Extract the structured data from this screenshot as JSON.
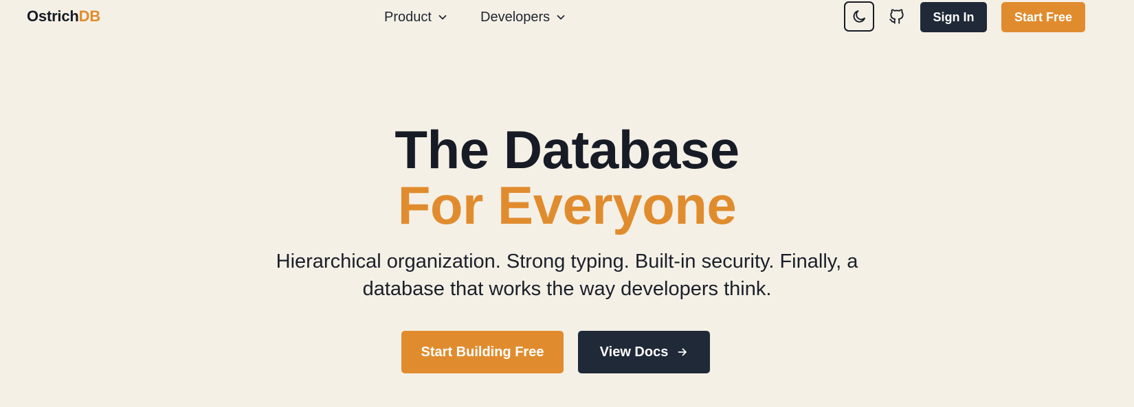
{
  "header": {
    "logo": {
      "main": "Ostrich",
      "accent": "DB"
    },
    "nav": [
      {
        "label": "Product",
        "icon": "chevron-down-icon"
      },
      {
        "label": "Developers",
        "icon": "chevron-down-icon"
      }
    ],
    "theme_toggle_icon": "moon-icon",
    "github_icon": "github-icon",
    "sign_in_label": "Sign In",
    "start_free_label": "Start Free"
  },
  "hero": {
    "title_line1": "The Database",
    "title_line2": "For Everyone",
    "subtitle_line1": "Hierarchical organization. Strong typing. Built-in security. Finally, a",
    "subtitle_line2": "database that works the way developers think.",
    "cta_primary_label": "Start Building Free",
    "cta_secondary_label": "View Docs",
    "cta_secondary_icon": "arrow-right-icon"
  },
  "colors": {
    "background": "#f5f0e6",
    "accent": "#e08c2e",
    "dark": "#1f2937",
    "text": "#161b25"
  }
}
